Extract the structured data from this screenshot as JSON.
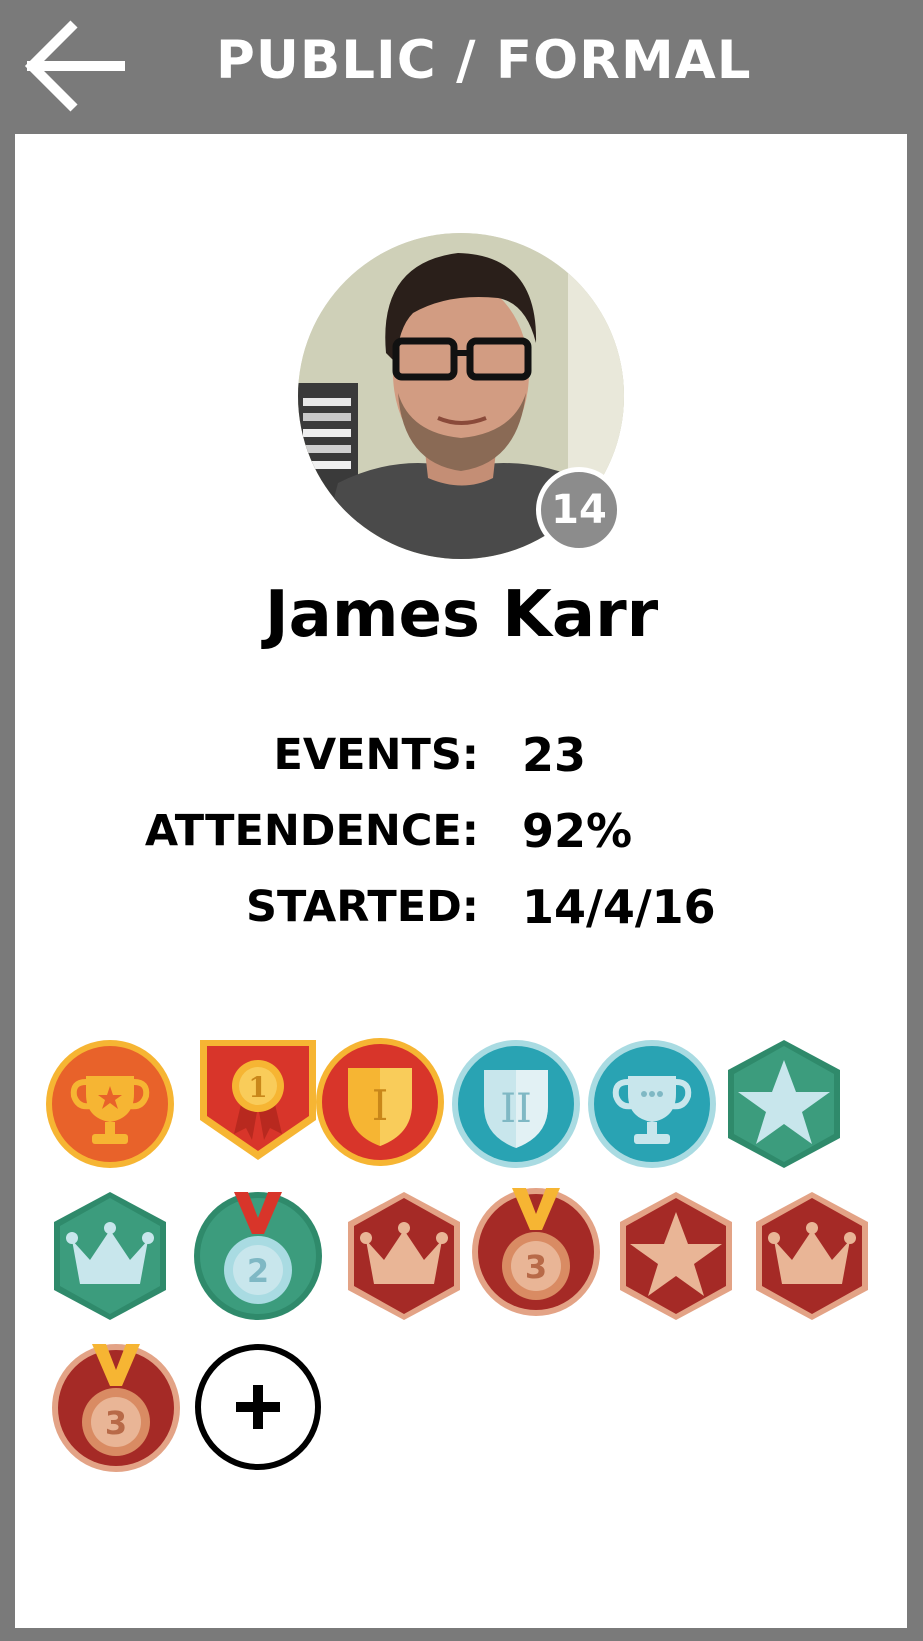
{
  "header": {
    "title": "PUBLIC / FORMAL",
    "back_icon": "arrow-left-icon",
    "background": "#7a7a7a"
  },
  "profile": {
    "name": "James Karr",
    "level": "14"
  },
  "stats": [
    {
      "label": "EVENTS:",
      "value": "23"
    },
    {
      "label": "ATTENDENCE:",
      "value": "92%"
    },
    {
      "label": "STARTED:",
      "value": "14/4/16"
    }
  ],
  "badges": [
    {
      "icon": "trophy-badge-icon",
      "color": "#e8622a"
    },
    {
      "icon": "ribbon-medal-1-badge-icon",
      "color": "#d8352a"
    },
    {
      "icon": "shield-i-badge-icon",
      "color": "#d8352a"
    },
    {
      "icon": "shield-ii-badge-icon",
      "color": "#29a3b3"
    },
    {
      "icon": "trophy-silver-badge-icon",
      "color": "#29a3b3"
    },
    {
      "icon": "star-hexagon-badge-icon",
      "color": "#3c9c7d"
    },
    {
      "icon": "crown-hexagon-badge-icon",
      "color": "#3c9c7d"
    },
    {
      "icon": "medal-2-badge-icon",
      "color": "#3c9c7d"
    },
    {
      "icon": "crown-hexagon-badge-icon",
      "color": "#a52a26"
    },
    {
      "icon": "medal-3-badge-icon",
      "color": "#a52a26"
    },
    {
      "icon": "star-hexagon-badge-icon",
      "color": "#a52a26"
    },
    {
      "icon": "crown-hexagon-badge-icon",
      "color": "#a52a26"
    },
    {
      "icon": "medal-3-badge-icon",
      "color": "#a52a26"
    }
  ],
  "add_badge_icon": "plus-icon"
}
